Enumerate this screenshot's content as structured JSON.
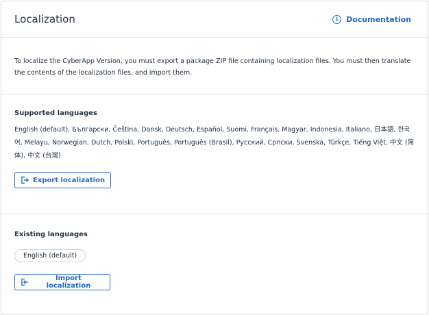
{
  "header": {
    "title": "Localization",
    "documentation_label": "Documentation"
  },
  "intro": {
    "text": "To localize the CyberApp Version, you must export a package ZIP file containing localization files. You must then translate the contents of the localization files, and import them."
  },
  "supported": {
    "title": "Supported languages",
    "languages": "English (default), Български, Čeština, Dansk, Deutsch, Español, Suomi, Français, Magyar, Indonesia, Italiano, 日本語, 한국어, Melayu, Norwegian, Dutch, Polski, Português, Português (Brasil), Русский, Српски, Svenska, Türkçe, Tiếng Việt, 中文 (简体), 中文 (台灣)",
    "export_label": "Export localization"
  },
  "existing": {
    "title": "Existing languages",
    "chips": [
      "English (default)"
    ],
    "import_label": "Import localization"
  },
  "colors": {
    "accent": "#2668c5",
    "text": "#243143",
    "border": "#dbe2ea"
  },
  "icons": {
    "documentation": "info-circle-icon",
    "export": "export-icon",
    "import": "import-icon"
  }
}
